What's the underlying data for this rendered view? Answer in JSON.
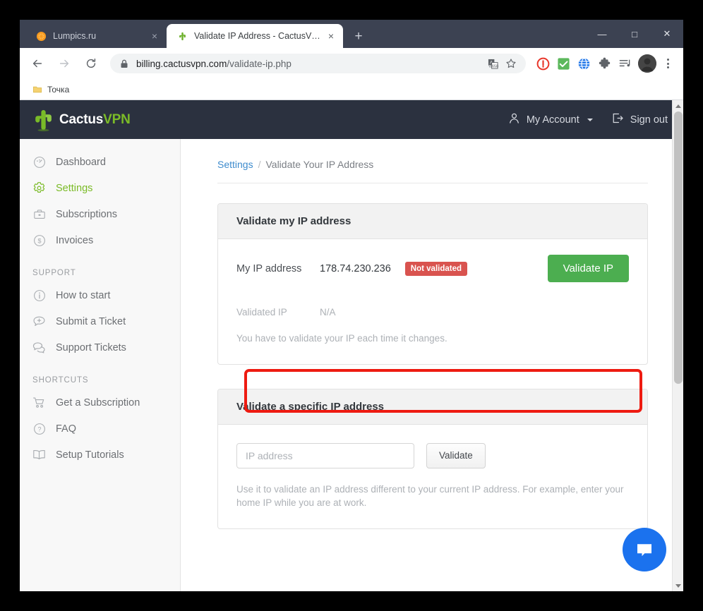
{
  "browser": {
    "tabs": [
      {
        "title": "Lumpics.ru",
        "favicon": "orange-circle-icon",
        "active": false,
        "close_label": "×"
      },
      {
        "title": "Validate IP Address - CactusVPN",
        "favicon": "cactus-icon",
        "active": true,
        "close_label": "×"
      }
    ],
    "new_tab_label": "+",
    "window_controls": {
      "minimize": "—",
      "maximize": "□",
      "close": "✕"
    },
    "nav": {
      "back": "←",
      "forward": "→",
      "reload": "⟳"
    },
    "omnibox": {
      "lock_icon": "lock-icon",
      "url_host": "billing.cactusvpn.com",
      "url_path": "/validate-ip.php",
      "translate_icon": "translate-icon",
      "bookmark_icon": "star-icon"
    },
    "extensions": [
      {
        "name": "adblock-extension-icon",
        "color": "#e8362a"
      },
      {
        "name": "checkmark-extension-icon",
        "color": "#5cb85c"
      },
      {
        "name": "globe-extension-icon",
        "color": "#1a73e8"
      },
      {
        "name": "puzzle-extensions-icon",
        "color": "#5f6368"
      },
      {
        "name": "playlist-music-icon",
        "color": "#5f6368"
      }
    ],
    "profile_avatar": "user-avatar",
    "menu_icon": "three-dots-menu-icon",
    "bookmarks": [
      {
        "label": "Точка",
        "icon": "folder-icon"
      }
    ]
  },
  "site": {
    "header": {
      "logo_cactus": "Cactus",
      "logo_vpn": "VPN",
      "account_label": "My Account",
      "signout_label": "Sign out"
    },
    "sidebar": {
      "primary": [
        {
          "label": "Dashboard",
          "icon": "gauge-icon",
          "active": false
        },
        {
          "label": "Settings",
          "icon": "gear-icon",
          "active": true
        },
        {
          "label": "Subscriptions",
          "icon": "briefcase-icon",
          "active": false
        },
        {
          "label": "Invoices",
          "icon": "dollar-circle-icon",
          "active": false
        }
      ],
      "support_heading": "SUPPORT",
      "support": [
        {
          "label": "How to start",
          "icon": "info-circle-icon"
        },
        {
          "label": "Submit a Ticket",
          "icon": "comment-plus-icon"
        },
        {
          "label": "Support Tickets",
          "icon": "comments-icon"
        }
      ],
      "shortcuts_heading": "SHORTCUTS",
      "shortcuts": [
        {
          "label": "Get a Subscription",
          "icon": "cart-icon"
        },
        {
          "label": "FAQ",
          "icon": "question-circle-icon"
        },
        {
          "label": "Setup Tutorials",
          "icon": "book-icon"
        }
      ]
    },
    "breadcrumb": {
      "parent": "Settings",
      "separator": "/",
      "current": "Validate Your IP Address"
    },
    "card_my_ip": {
      "title": "Validate my IP address",
      "ip_label": "My IP address",
      "ip_value": "178.74.230.236",
      "status_badge": "Not validated",
      "validate_button": "Validate IP",
      "validated_label": "Validated IP",
      "validated_value": "N/A",
      "note": "You have to validate your IP each time it changes."
    },
    "card_specific_ip": {
      "title": "Validate a specific IP address",
      "input_placeholder": "IP address",
      "input_value": "",
      "validate_button": "Validate",
      "note": "Use it to validate an IP address different to your current IP address. For example, enter your home IP while you are at work."
    },
    "chat_widget_icon": "chat-bubble-icon",
    "colors": {
      "accent_green": "#7bbb27",
      "button_green": "#4cae50",
      "badge_red": "#d9534f",
      "header_dark": "#2b313f",
      "link_blue": "#3d8bcd",
      "highlight_red": "#ee1b11",
      "chat_blue": "#1b72ee"
    }
  }
}
